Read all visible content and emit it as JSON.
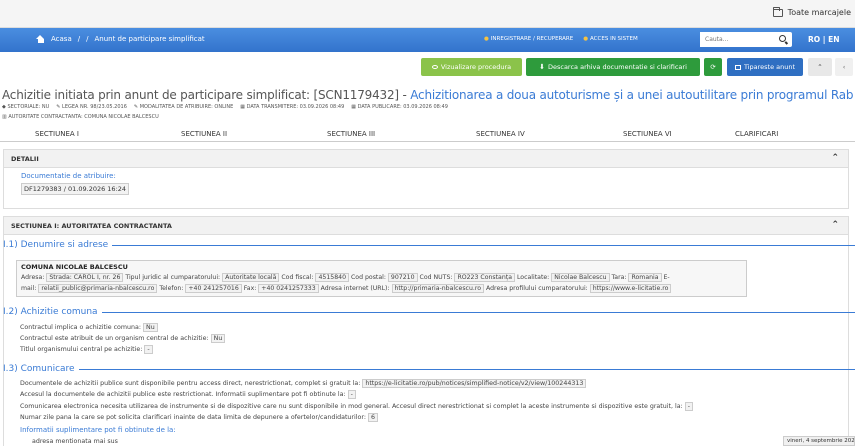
{
  "bookmarks": {
    "folder_label": "Toate marcajele"
  },
  "nav": {
    "home": "Acasa",
    "sep1": "/",
    "sep2": "/",
    "crumb": "Anunt de participare simplificat",
    "register": "INREGISTRARE / RECUPERARE",
    "login": "ACCES IN SISTEM",
    "search_placeholder": "Cauta...",
    "lang": "RO | EN"
  },
  "toolbar": {
    "view": "Vizualizare procedura",
    "download": "Descarca arhiva documentatie si clarificari",
    "refresh": "⟳",
    "print": "Tipareste anunt",
    "up": "⌃",
    "back": "‹"
  },
  "title": {
    "prefix": "Achizitie initiata prin anunt de participare simplificat: [SCN1179432] - ",
    "link": "Achizitionarea a doua autoturisme și a unei autoutilitare prin programul Rabla privind reducerea..."
  },
  "meta": {
    "sectoriale": "SECTORIALE: NU",
    "lege": "LEGEA NR. 98/23.05.2016",
    "modalitate": "MODALITATEA DE ATRIBUIRE: ONLINE",
    "transmitere": "DATA TRANSMITERE: 03.09.2026 08:49",
    "publicare": "DATA PUBLICARE: 03.09.2026 08:49",
    "autoritate": "AUTORITATE CONTRACTANTA: COMUNA NICOLAE BALCESCU"
  },
  "tabs": [
    "SECTIUNEA I",
    "SECTIUNEA II",
    "SECTIUNEA III",
    "SECTIUNEA IV",
    "SECTIUNEA VI",
    "CLARIFICARI"
  ],
  "detalii": {
    "header": "DETALII",
    "doc_label": "Documentatie de atribuire:",
    "doc_value": "DF1279383 / 01.09.2026 16:24"
  },
  "sectiunea1": {
    "header": "SECTIUNEA I: AUTORITATEA CONTRACTANTA",
    "h1": "I.1) Denumire si adrese",
    "name": "COMUNA NICOLAE BALCESCU",
    "adresa_label": "Adresa:",
    "adresa": "Strada: CAROL I, nr. 26",
    "tip_label": "Tipul juridic al cumparatorului:",
    "tip": "Autoritate locală",
    "cod_fiscal_label": "Cod fiscal:",
    "cod_fiscal": "4515840",
    "cod_postal_label": "Cod postal:",
    "cod_postal": "907210",
    "nuts_label": "Cod NUTS:",
    "nuts": "RO223 Constanța",
    "localitate_label": "Localitate:",
    "localitate": "Nicolae Balcescu",
    "tara_label": "Tara:",
    "tara": "Romania",
    "email_label": "E-",
    "email_label2": "mail:",
    "email": "relatii_public@primaria-nbalcescu.ro",
    "telefon_label": "Telefon:",
    "telefon": "+40 241257016",
    "fax_label": "Fax:",
    "fax": "+40 0241257333",
    "internet_label": "Adresa internet (URL):",
    "internet": "http://primaria-nbalcescu.ro",
    "profil_label": "Adresa profilului cumparatorului:",
    "profil": "https://www.e-licitatie.ro",
    "h2": "I.2) Achizitie comuna",
    "comuna_q": "Contractul implica o achizitie comuna:",
    "comuna_a": "Nu",
    "central_q": "Contractul este atribuit de un organism central de achizitie:",
    "central_a": "Nu",
    "titlu_q": "Titlul organismului central pe achizitie:",
    "titlu_a": "-",
    "h3": "I.3) Comunicare",
    "com1": "Documentele de achizitii publice sunt disponibile pentru access direct, nerestrictionat, complet si gratuit la:",
    "com1_url": "https://e-licitatie.ro/pub/notices/simplified-notice/v2/view/100244313",
    "com2": "Accesul la documentele de achizitii publice este restrictionat. Informatii suplimentare pot fi obtinute la:",
    "com2_a": "-",
    "com3": "Comunicarea electronica necesita utilizarea de instrumente si de dispozitive care nu sunt disponibile in mod general. Accesul direct nerestrictionat si complet la aceste instrumente si dispozitive este gratuit, la:",
    "com3_a": "-",
    "com4": "Numar zile pana la care se pot solicita clarificari inainte de data limita de depunere a ofertelor/candidaturilor:",
    "com4_a": "6",
    "info": "Informatii suplimentare pot fi obtinute de la:",
    "info_val": "adresa mentionata mai sus"
  },
  "status": "vineri, 4 septembrie 2026"
}
